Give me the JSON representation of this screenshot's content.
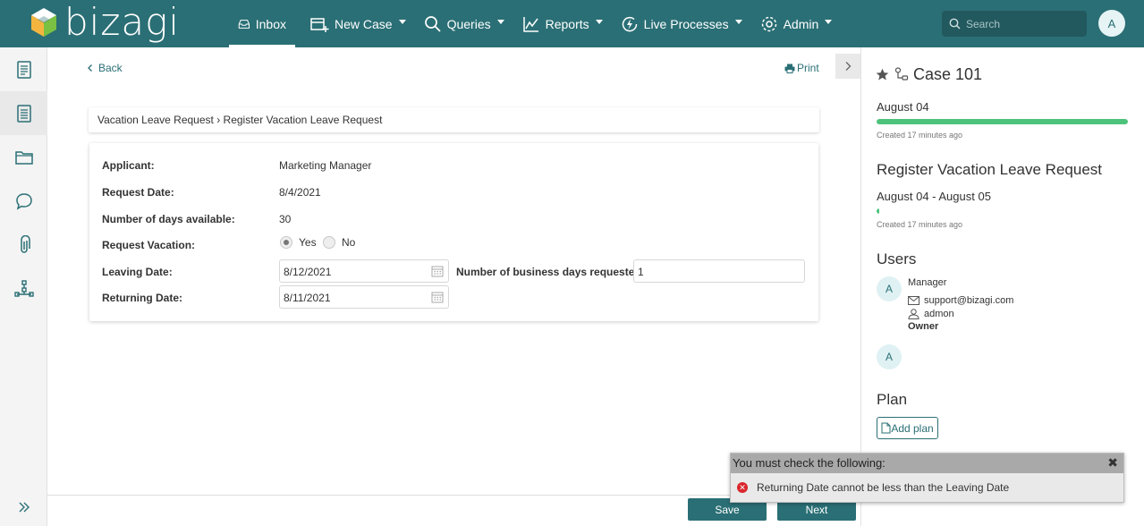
{
  "colors": {
    "brand": "#2a6f75",
    "progress": "#4cc27a",
    "error": "#d9262c"
  },
  "header": {
    "logo_text": "bizagi",
    "nav": [
      {
        "label": "Inbox",
        "icon": "inbox-icon",
        "active": true
      },
      {
        "label": "New Case",
        "icon": "new-case-icon"
      },
      {
        "label": "Queries",
        "icon": "search-icon"
      },
      {
        "label": "Reports",
        "icon": "chart-icon"
      },
      {
        "label": "Live Processes",
        "icon": "bolt-icon"
      },
      {
        "label": "Admin",
        "icon": "gear-icon"
      }
    ],
    "search_placeholder": "Search",
    "avatar": "A"
  },
  "sidebar": {
    "items": [
      {
        "icon": "document-icon"
      },
      {
        "icon": "form-icon",
        "active": true
      },
      {
        "icon": "folder-icon"
      },
      {
        "icon": "comment-icon"
      },
      {
        "icon": "attachment-icon"
      },
      {
        "icon": "workflow-icon"
      },
      {
        "icon": "expand-icon"
      }
    ]
  },
  "main": {
    "back_label": "Back",
    "print_label": "Print",
    "breadcrumb": "Vacation Leave Request › Register Vacation Leave Request",
    "form": {
      "applicant_label": "Applicant:",
      "applicant_value": "Marketing Manager",
      "request_date_label": "Request Date:",
      "request_date_value": "8/4/2021",
      "days_available_label": "Number of days available:",
      "days_available_value": "30",
      "request_vacation_label": "Request Vacation:",
      "yes_label": "Yes",
      "no_label": "No",
      "leaving_date_label": "Leaving Date:",
      "leaving_date_value": "8/12/2021",
      "business_days_label": "Number of business days requested:",
      "business_days_value": "1",
      "returning_date_label": "Returning Date:",
      "returning_date_value": "8/11/2021"
    },
    "save_label": "Save",
    "next_label": "Next"
  },
  "panel": {
    "case_title": "Case 101",
    "case_date": "August 04",
    "case_progress": 1.0,
    "case_created": "Created 17 minutes ago",
    "task_title": "Register Vacation Leave Request",
    "task_dates": "August 04 - August 05",
    "task_progress": 0.01,
    "task_created": "Created 17 minutes ago",
    "users_heading": "Users",
    "user_avatar": "A",
    "user_role": "Manager",
    "user_email": "support@bizagi.com",
    "user_login": "admon",
    "user_owner": "Owner",
    "user2_avatar": "A",
    "plan_heading": "Plan",
    "add_plan_label": "Add plan"
  },
  "error": {
    "title": "You must check the following:",
    "close": "✖",
    "icon_glyph": "✕",
    "message": "Returning Date cannot be less than the Leaving Date"
  }
}
